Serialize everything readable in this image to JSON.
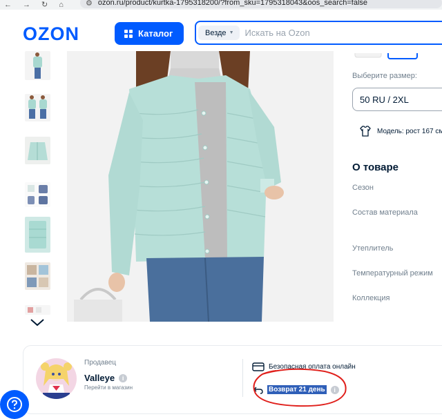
{
  "browser": {
    "url": "ozon.ru/product/kurtka-1795318200/?from_sku=1795318043&oos_search=false",
    "nav_back": "←",
    "nav_forward": "→",
    "nav_reload": "↻",
    "nav_home": "⌂"
  },
  "header": {
    "logo": "OZON",
    "catalog_label": "Каталог",
    "search_scope": "Везде",
    "search_placeholder": "Искать на Ozon",
    "accent_color": "#005bff"
  },
  "gallery": {
    "thumbnail_count": 7,
    "scroll_icon": "chevron-down-icon"
  },
  "product": {
    "size_label": "Выберите размер:",
    "size_value": "50 RU / 2XL",
    "model_info": "Модель: рост 167 см",
    "about_title": "О товаре",
    "properties": [
      "Сезон",
      "Состав материала",
      "Утеплитель",
      "Температурный режим",
      "Коллекция"
    ]
  },
  "seller": {
    "title": "Продавец",
    "name": "Valleye",
    "link": "Перейти в магазин",
    "feature_payment": "Безопасная оплата онлайн",
    "feature_return": "Возврат 21 день",
    "annotation_color": "#e0201c"
  },
  "help": {
    "icon": "help-icon"
  }
}
